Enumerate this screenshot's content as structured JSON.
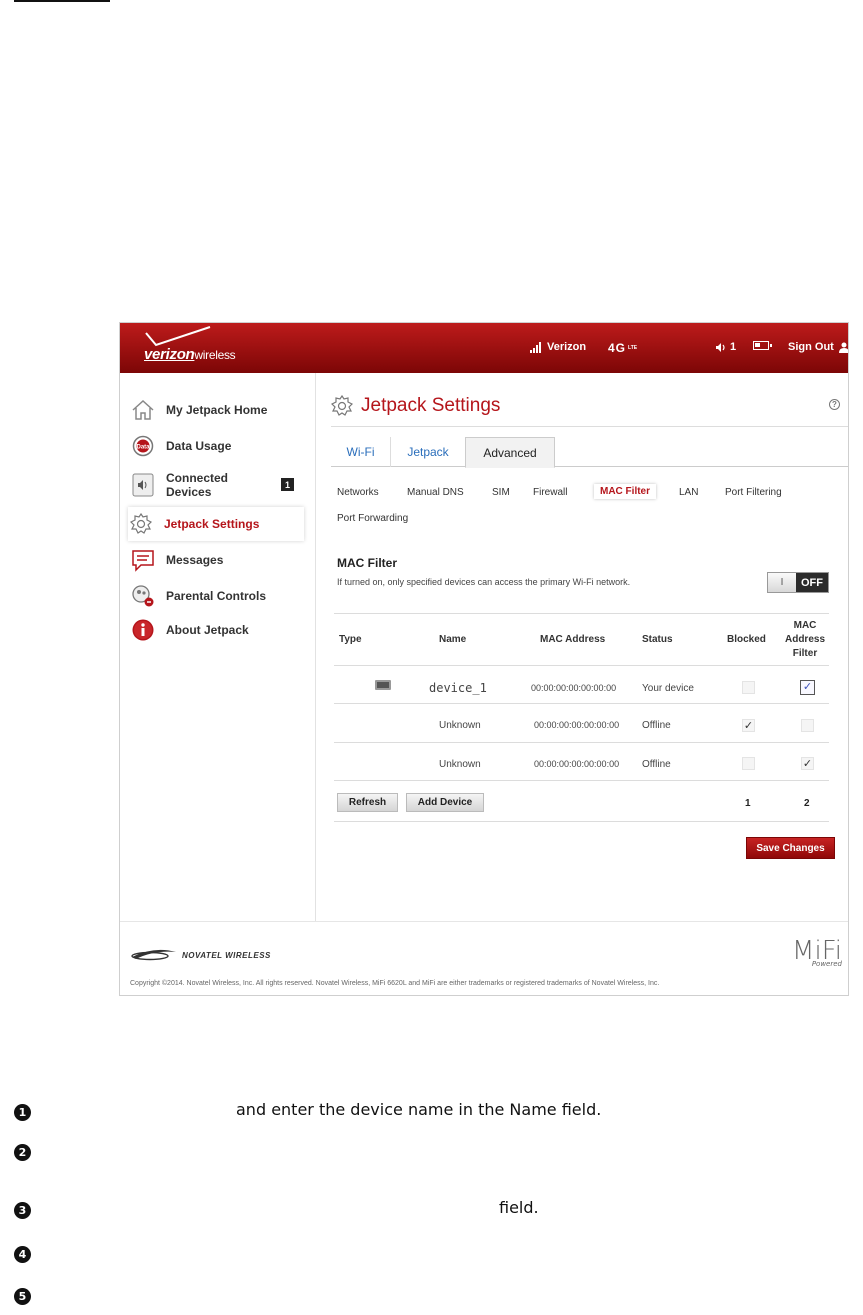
{
  "header": {
    "brand_bold": "verizon",
    "brand_light": "wireless",
    "carrier": "Verizon",
    "network": "4G",
    "network_sub": "LTE",
    "connected_count": "1",
    "sign_out": "Sign Out"
  },
  "sidebar": {
    "items": [
      {
        "label": "My Jetpack Home",
        "icon": "home-icon"
      },
      {
        "label": "Data Usage",
        "icon": "data-usage-icon"
      },
      {
        "label": "Connected Devices",
        "icon": "speaker-icon",
        "badge": "1"
      },
      {
        "label": "Jetpack Settings",
        "icon": "gear-icon",
        "active": true
      },
      {
        "label": "Messages",
        "icon": "messages-icon"
      },
      {
        "label": "Parental Controls",
        "icon": "parental-controls-icon"
      },
      {
        "label": "About Jetpack",
        "icon": "info-icon"
      }
    ]
  },
  "main": {
    "title": "Jetpack Settings",
    "help": "?",
    "tabs": [
      "Wi-Fi",
      "Jetpack",
      "Advanced"
    ],
    "active_tab": "Advanced",
    "subtabs": [
      "Networks",
      "Manual DNS",
      "SIM",
      "Firewall",
      "MAC Filter",
      "LAN",
      "Port Filtering",
      "Port Forwarding"
    ],
    "active_subtab": "MAC Filter",
    "mac_filter": {
      "title": "MAC Filter",
      "description": "If turned on, only specified devices can access the primary Wi-Fi network.",
      "toggle_on": "I",
      "toggle_off": "OFF"
    },
    "table": {
      "headers": [
        "Type",
        "Name",
        "MAC Address",
        "Status",
        "Blocked",
        "MAC Address Filter"
      ],
      "rows": [
        {
          "name": "device_1",
          "mac": "00:00:00:00:00:00:00",
          "status": "Your device",
          "blocked": false,
          "filter": true
        },
        {
          "name": "Unknown",
          "mac": "00:00:00:00:00:00:00",
          "status": "Offline",
          "blocked": true,
          "filter": false
        },
        {
          "name": "Unknown",
          "mac": "00:00:00:00:00:00:00",
          "status": "Offline",
          "blocked": false,
          "filter": true
        }
      ],
      "blocked_total": "1",
      "filter_total": "2"
    },
    "buttons": {
      "refresh": "Refresh",
      "add_device": "Add Device",
      "save": "Save Changes"
    }
  },
  "footer": {
    "novatel": "NOVATEL WIRELESS",
    "mifi": "MiFi",
    "mifi_sub": "Powered",
    "copyright": "Copyright ©2014. Novatel Wireless, Inc. All rights reserved. Novatel Wireless, MiFi 6620L and MiFi are either trademarks or registered trademarks of Novatel Wireless, Inc."
  },
  "steps": [
    {
      "num": "1",
      "text": "and enter the device name in the Name field."
    },
    {
      "num": "2",
      "text": ""
    },
    {
      "num": "3",
      "text": "field."
    },
    {
      "num": "4",
      "text": ""
    },
    {
      "num": "5",
      "text": ""
    }
  ],
  "colors": {
    "brand_red": "#b5151b",
    "link_blue": "#2a6ebb"
  }
}
